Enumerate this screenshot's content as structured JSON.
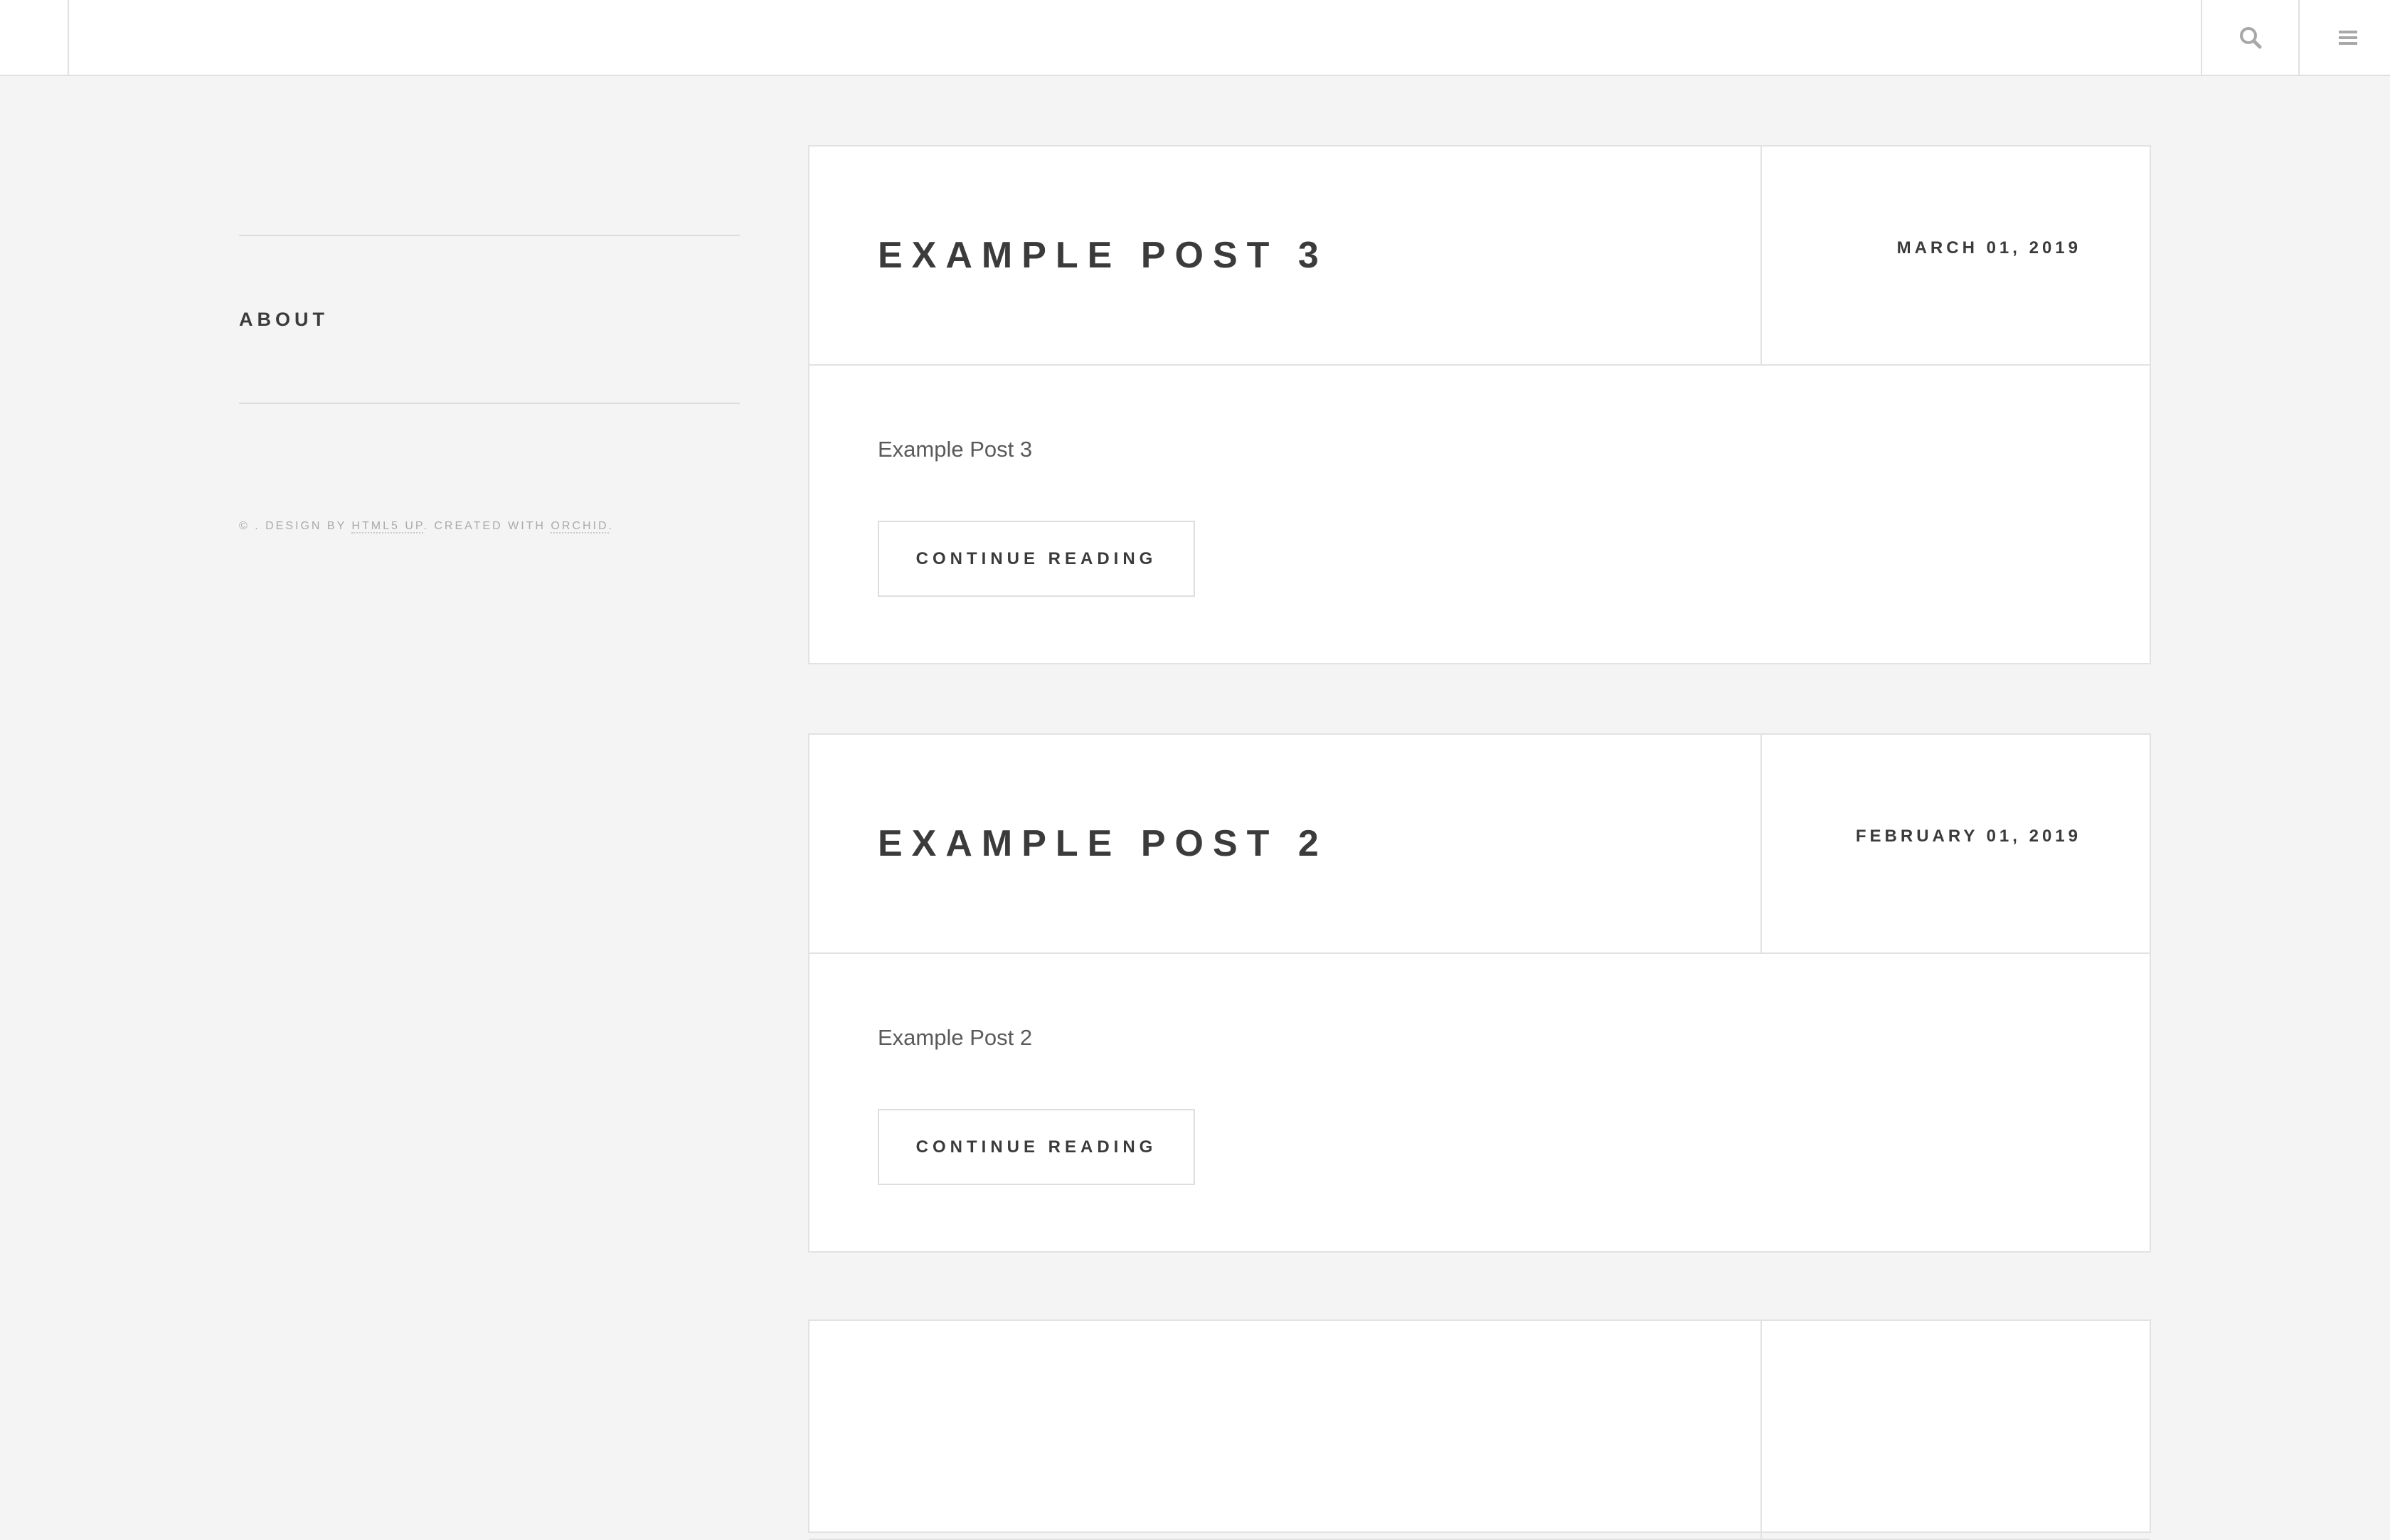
{
  "header": {
    "search_icon": "search-icon",
    "menu_icon": "menu-icon"
  },
  "sidebar": {
    "about_title": "ABOUT",
    "footer": {
      "prefix": "© . DESIGN BY ",
      "design_link": "HTML5 UP",
      "middle": ". CREATED WITH ",
      "created_link": "ORCHID",
      "suffix": "."
    }
  },
  "posts": [
    {
      "title": "EXAMPLE POST 3",
      "date": "MARCH 01, 2019",
      "excerpt": "Example Post 3",
      "button_label": "CONTINUE READING"
    },
    {
      "title": "EXAMPLE POST 2",
      "date": "FEBRUARY 01, 2019",
      "excerpt": "Example Post 2",
      "button_label": "CONTINUE READING"
    }
  ],
  "colors": {
    "background": "#f4f4f4",
    "card": "#ffffff",
    "text": "#3c3b3b",
    "border": "#e2e2e2",
    "muted": "#aaaaaa"
  }
}
